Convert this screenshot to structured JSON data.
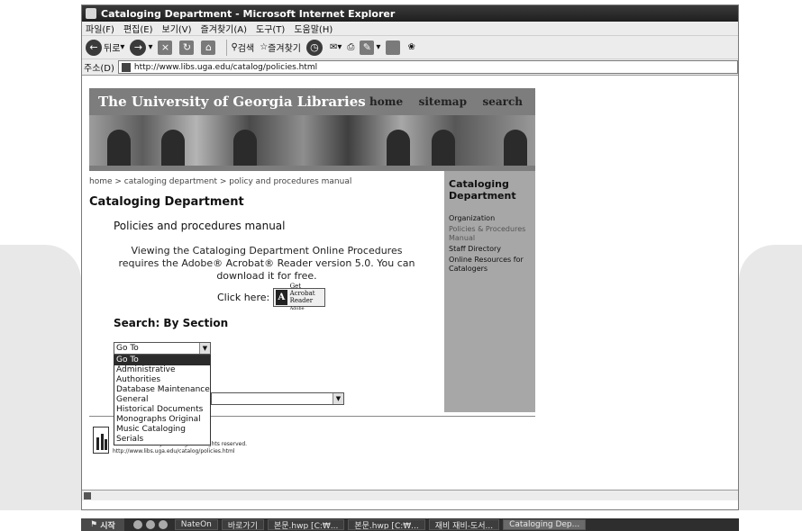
{
  "window": {
    "title": "Cataloging Department - Microsoft Internet Explorer"
  },
  "menu": [
    "파일(F)",
    "편집(E)",
    "보기(V)",
    "즐겨찾기(A)",
    "도구(T)",
    "도움말(H)"
  ],
  "toolbar": {
    "back_label": "뒤로",
    "search_label": "검색",
    "favorites_label": "즐겨찾기"
  },
  "address": {
    "label": "주소(D)",
    "url": "http://www.libs.uga.edu/catalog/policies.html"
  },
  "site": {
    "title": "The University of Georgia Libraries",
    "nav": [
      "home",
      "sitemap",
      "search"
    ]
  },
  "breadcrumb": "home > cataloging department > policy and procedures manual",
  "page_title": "Cataloging Department",
  "section_title": "Policies and procedures manual",
  "intro": "Viewing the Cataloging Department Online Procedures requires the Adobe® Acrobat® Reader version 5.0. You can download it for free.",
  "click_here": "Click here:",
  "acrobat_badge": {
    "get": "Get",
    "brand": "Acrobat",
    "product": "Reader",
    "maker": "Adobe"
  },
  "search_heading": "Search: By Section",
  "goto_select": {
    "value": "Go To",
    "options": [
      "Go To",
      "Administrative",
      "Authorities",
      "Database Maintenance",
      "General",
      "Historical Documents",
      "Monographs Original",
      "Music Cataloging",
      "Serials"
    ]
  },
  "sidebar": {
    "title": "Cataloging Department",
    "links": [
      "Organization",
      "Policies & Procedures Manual",
      "Staff Directory",
      "Online Resources for Catalogers"
    ]
  },
  "footer": {
    "copyright": "© 2003 University of Georgia. All rights reserved.",
    "url": "http://www.libs.uga.edu/catalog/policies.html"
  },
  "taskbar": {
    "start": "시작",
    "items": [
      "NateOn",
      "바로가기",
      "본문.hwp [C:₩...",
      "본문.hwp [C:₩...",
      "재비 재비-도서...",
      "Cataloging Dep..."
    ]
  }
}
